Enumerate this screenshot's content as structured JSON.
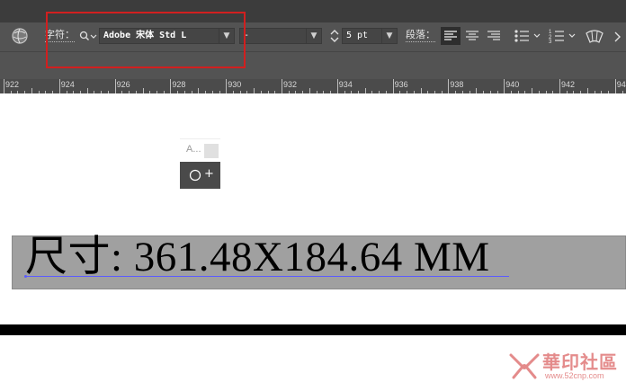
{
  "toolbar": {
    "char_label": "字符：",
    "font_family": "Adobe 宋体 Std L",
    "font_style": "-",
    "font_size": "5 pt",
    "para_label": "段落："
  },
  "ruler": {
    "labels": [
      "922",
      "924",
      "926",
      "928",
      "930",
      "932",
      "934",
      "936",
      "938",
      "940",
      "942",
      "944"
    ]
  },
  "widget": {
    "label": "A...",
    "plus": "+"
  },
  "artboard": {
    "text": "尺寸: 361.48X184.64 MM"
  },
  "watermark": {
    "text": "華印社區",
    "url": "www.52cnp.com"
  },
  "colors": {
    "highlight_box": "#d11f1f",
    "text_frame_bg": "#a0a0a0",
    "baseline": "#5a5aff",
    "watermark": "#e48b8b"
  }
}
